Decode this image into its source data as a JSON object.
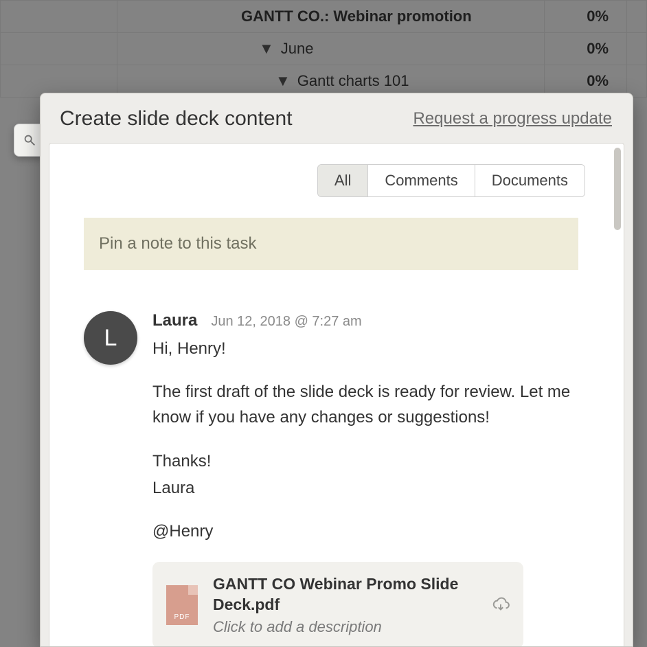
{
  "background": {
    "rows": [
      {
        "name": "GANTT CO.: Webinar promotion",
        "percent": "0%",
        "bold": true,
        "indent": 0
      },
      {
        "name": "June",
        "percent": "0%",
        "bold": false,
        "indent": 1
      },
      {
        "name": "Gantt charts 101",
        "percent": "0%",
        "bold": false,
        "indent": 2
      }
    ]
  },
  "sidetab": {
    "icon_name": "detach-icon"
  },
  "modal": {
    "title": "Create slide deck content",
    "request_link": "Request a progress update",
    "tabs": {
      "all": "All",
      "comments": "Comments",
      "documents": "Documents",
      "active": "all"
    },
    "pin_placeholder": "Pin a note to this task",
    "comment": {
      "author": "Laura",
      "avatar_initial": "L",
      "timestamp": "Jun 12, 2018 @ 7:27 am",
      "p1": "Hi, Henry!",
      "p2": "The first draft of the slide deck is ready for review. Let me know if you have any changes or suggestions!",
      "p3": "Thanks!",
      "p4": "Laura",
      "p5": "@Henry",
      "attachment": {
        "type_label": "PDF",
        "filename": "GANTT CO Webinar Promo Slide Deck.pdf",
        "desc_placeholder": "Click to add a description"
      }
    }
  }
}
